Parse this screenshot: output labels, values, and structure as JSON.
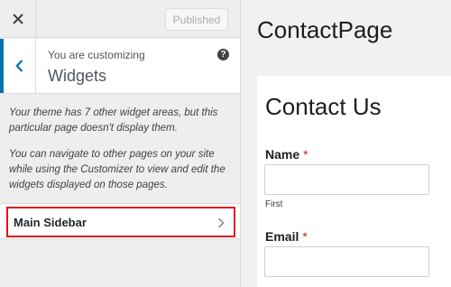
{
  "customizer": {
    "publish_label": "Published",
    "customizing_label": "You are customizing",
    "section_title": "Widgets",
    "help_symbol": "?",
    "description_1": "Your theme has 7 other widget areas, but this particular page doesn't display them.",
    "description_2": "You can navigate to other pages on your site while using the Customizer to view and edit the widgets displayed on those pages.",
    "widget_area": "Main Sidebar"
  },
  "preview": {
    "site_title": "ContactPage",
    "page_heading": "Contact Us",
    "fields": [
      {
        "label": "Name",
        "required_mark": "*",
        "sublabel": "First"
      },
      {
        "label": "Email",
        "required_mark": "*"
      }
    ]
  },
  "colors": {
    "accent": "#0073aa",
    "highlight": "#e0141e",
    "required": "#c02b0a"
  },
  "icons": {
    "close": "close-icon",
    "back": "chevron-left-icon",
    "help": "help-icon",
    "widget_area_arrow": "chevron-right-icon"
  }
}
